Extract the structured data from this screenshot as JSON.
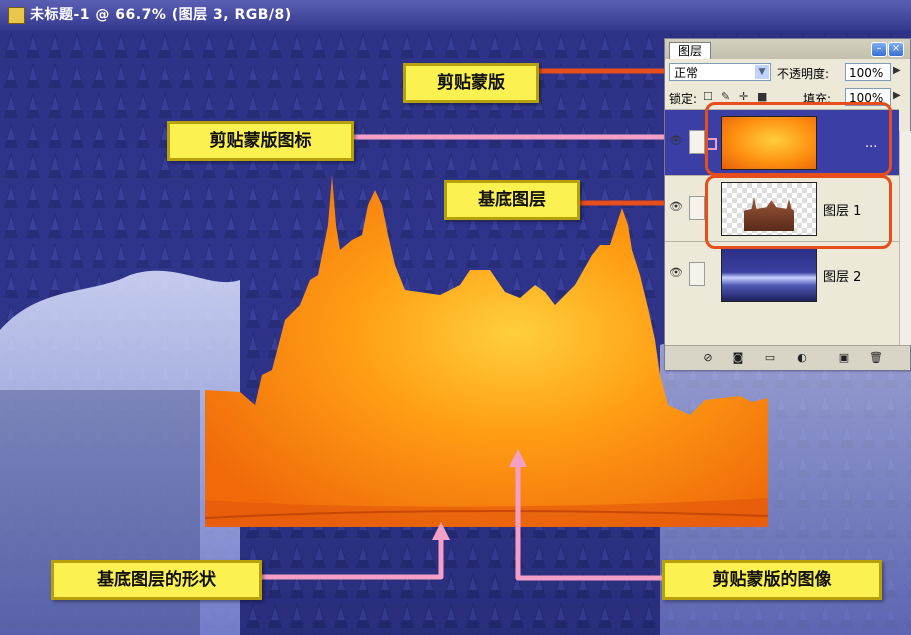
{
  "window": {
    "title": "未标题-1 @ 66.7% (图层 3, RGB/8)"
  },
  "panel": {
    "tab": "图层",
    "blend_mode": "正常",
    "opacity_label": "不透明度:",
    "opacity_value": "100%",
    "lock_label": "锁定:",
    "fill_label": "填充:",
    "fill_value": "100%",
    "layers": [
      {
        "name": "",
        "more": "...",
        "selected": true
      },
      {
        "name": "图层 1",
        "selected": false
      },
      {
        "name": "图层 2",
        "selected": false
      }
    ]
  },
  "callouts": {
    "clipping_mask": "剪贴蒙版",
    "clipping_mask_icon": "剪贴蒙版图标",
    "base_layer": "基底图层",
    "base_layer_shape": "基底图层的形状",
    "clipping_mask_image": "剪贴蒙版的图像"
  },
  "icons": [
    "app-icon",
    "minimize-icon",
    "close-icon",
    "panel-menu-icon",
    "eye-icon",
    "lock-transparency-icon",
    "lock-brush-icon",
    "lock-move-icon",
    "lock-all-icon",
    "link-layers-icon",
    "layer-style-icon",
    "add-mask-icon",
    "new-group-icon",
    "adjustment-layer-icon",
    "new-layer-icon",
    "trash-icon"
  ],
  "colors": {
    "callout_fill": "#fbf150",
    "highlight": "#e84d1c",
    "callout_arrow": "#f4a0c6",
    "selection": "#3b3fa5"
  }
}
